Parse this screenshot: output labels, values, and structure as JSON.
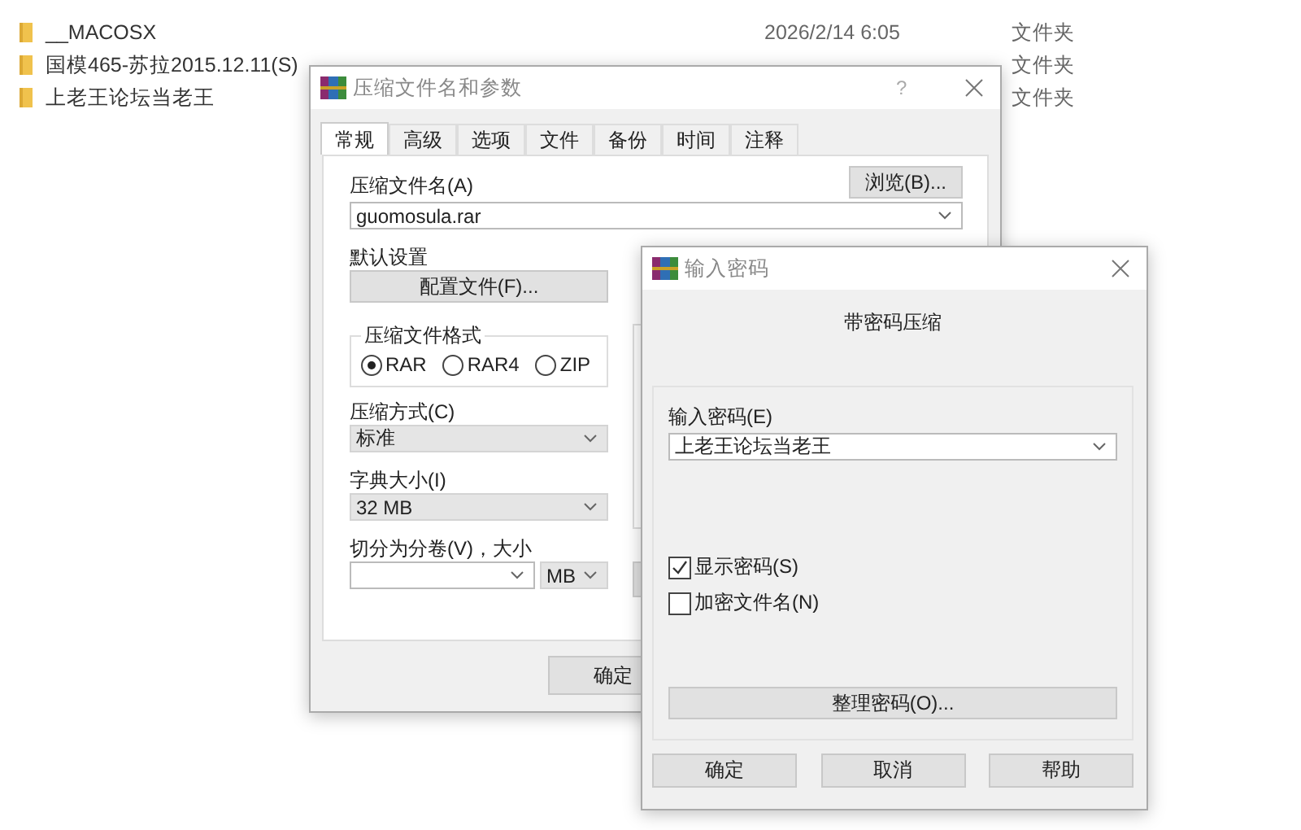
{
  "explorer": {
    "rows": [
      {
        "name": "__MACOSX",
        "modified": "2026/2/14 6:05",
        "type": "文件夹"
      },
      {
        "name": "国模465-苏拉2015.12.11(S)",
        "type": "文件夹"
      },
      {
        "name": "上老王论坛当老王",
        "type": "文件夹"
      }
    ]
  },
  "archive_dialog": {
    "title": "压缩文件名和参数",
    "help": "?",
    "tabs": [
      {
        "label": "常规",
        "selected": true
      },
      {
        "label": "高级",
        "selected": false
      },
      {
        "label": "选项",
        "selected": false
      },
      {
        "label": "文件",
        "selected": false
      },
      {
        "label": "备份",
        "selected": false
      },
      {
        "label": "时间",
        "selected": false
      },
      {
        "label": "注释",
        "selected": false
      }
    ],
    "archive_name_label": "压缩文件名(A)",
    "browse_button": "浏览(B)...",
    "archive_name": "guomosula.rar",
    "profile_label": "默认设置",
    "profile_button": "配置文件(F)...",
    "format_group": "压缩文件格式",
    "formats": [
      {
        "label": "RAR",
        "selected": true
      },
      {
        "label": "RAR4",
        "selected": false
      },
      {
        "label": "ZIP",
        "selected": false
      }
    ],
    "method_label": "压缩方式(C)",
    "method": "标准",
    "dictionary_label": "字典大小(I)",
    "dictionary": "32 MB",
    "split_label": "切分为分卷(V)，大小",
    "split_unit": "MB",
    "ok_button": "确定"
  },
  "password_dialog": {
    "title": "输入密码",
    "heading": "带密码压缩",
    "password_label": "输入密码(E)",
    "password": "上老王论坛当老王",
    "options": [
      {
        "label": "显示密码(S)",
        "checked": true
      },
      {
        "label": "加密文件名(N)",
        "checked": false
      }
    ],
    "organize_button": "整理密码(O)...",
    "buttons": [
      "确定",
      "取消",
      "帮助"
    ]
  }
}
